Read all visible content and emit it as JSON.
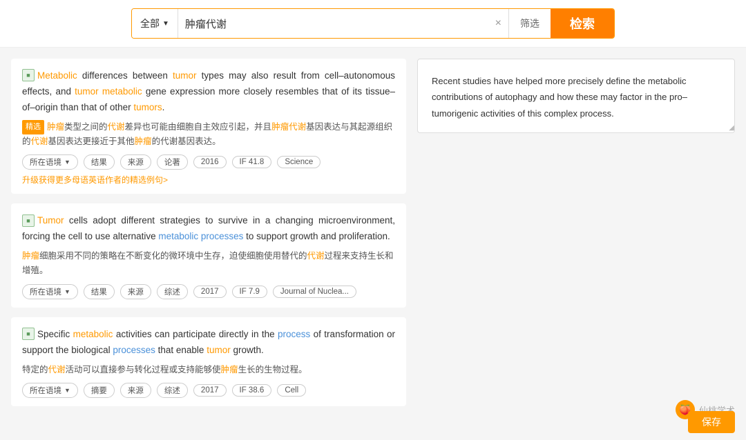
{
  "search": {
    "category_label": "全部",
    "query": "肿瘤代谢",
    "filter_label": "筛选",
    "search_label": "检索",
    "clear_icon": "×"
  },
  "results": [
    {
      "id": 1,
      "icon_letter": "M",
      "en_parts": [
        {
          "text": "",
          "type": "normal"
        },
        {
          "text": "Metabolic",
          "type": "orange"
        },
        {
          "text": " differences between ",
          "type": "normal"
        },
        {
          "text": "tumor",
          "type": "orange"
        },
        {
          "text": " types may also result from cell–autonomous effects, and ",
          "type": "normal"
        },
        {
          "text": "tumor",
          "type": "orange"
        },
        {
          "text": " ",
          "type": "normal"
        },
        {
          "text": "metabolic",
          "type": "orange"
        },
        {
          "text": " gene expression more closely resembles that of its tissue–of–origin than that of other ",
          "type": "normal"
        },
        {
          "text": "tumors",
          "type": "orange"
        },
        {
          "text": ".",
          "type": "normal"
        }
      ],
      "zh_badge": "精选",
      "zh_parts": [
        {
          "text": "肿瘤",
          "type": "orange"
        },
        {
          "text": "类型之间的",
          "type": "normal"
        },
        {
          "text": "代谢",
          "type": "orange"
        },
        {
          "text": "差异也可能由细胞自主效应引起，并且",
          "type": "normal"
        },
        {
          "text": "肿瘤代谢",
          "type": "orange"
        },
        {
          "text": "基因表达与其起源组织的",
          "type": "normal"
        },
        {
          "text": "代谢",
          "type": "orange"
        },
        {
          "text": "基因表达更接近于其他",
          "type": "normal"
        },
        {
          "text": "肿瘤",
          "type": "orange"
        },
        {
          "text": "的代谢基因表达。",
          "type": "normal"
        }
      ],
      "tags": [
        "所在语境",
        "结果",
        "来源",
        "论著",
        "2016",
        "IF 41.8",
        "Science"
      ],
      "upgrade_text": "升级获得更多母语英语作者的精选例句>",
      "show_dropdown": [
        true,
        false,
        false,
        false,
        false,
        false,
        false
      ]
    },
    {
      "id": 2,
      "icon_letter": "T",
      "en_parts": [
        {
          "text": "Tumor",
          "type": "orange"
        },
        {
          "text": " cells adopt different strategies to survive in a changing microenvironment, forcing the cell to use alternative ",
          "type": "normal"
        },
        {
          "text": "metabolic processes",
          "type": "blue"
        },
        {
          "text": " to support growth and proliferation.",
          "type": "normal"
        }
      ],
      "zh_parts": [
        {
          "text": "肿瘤",
          "type": "orange"
        },
        {
          "text": "细胞采用不同的策略在不断变化的微环境中生存，迫使细胞使用替代的",
          "type": "normal"
        },
        {
          "text": "代谢",
          "type": "orange"
        },
        {
          "text": "过程来支持生长和增殖。",
          "type": "normal"
        }
      ],
      "tags": [
        "所在语境",
        "结果",
        "来源",
        "综述",
        "2017",
        "IF 7.9",
        "Journal of Nuclea..."
      ],
      "show_dropdown": [
        true,
        false,
        false,
        false,
        false,
        false,
        false
      ]
    },
    {
      "id": 3,
      "icon_letter": "S",
      "en_parts": [
        {
          "text": "Specific ",
          "type": "normal"
        },
        {
          "text": "metabolic",
          "type": "orange"
        },
        {
          "text": " activities can participate directly in the ",
          "type": "normal"
        },
        {
          "text": "process",
          "type": "blue"
        },
        {
          "text": " of transformation or support the biological ",
          "type": "normal"
        },
        {
          "text": "processes",
          "type": "blue"
        },
        {
          "text": " that enable ",
          "type": "normal"
        },
        {
          "text": "tumor",
          "type": "orange"
        },
        {
          "text": " growth.",
          "type": "normal"
        }
      ],
      "zh_parts": [
        {
          "text": "特定的",
          "type": "normal"
        },
        {
          "text": "代谢",
          "type": "orange"
        },
        {
          "text": "活动可以直接参与转化过程或支持能够使",
          "type": "normal"
        },
        {
          "text": "肿瘤",
          "type": "orange"
        },
        {
          "text": "生长的生物过程。",
          "type": "normal"
        }
      ],
      "tags": [
        "所在语境",
        "摘要",
        "来源",
        "综述",
        "2017",
        "IF 38.6",
        "Cell"
      ],
      "show_dropdown": [
        true,
        false,
        false,
        false,
        false,
        false,
        false
      ]
    }
  ],
  "preview": {
    "text": "Recent studies have helped more precisely define the metabolic contributions of autophagy and how these may factor in the pro–tumorigenic activities of this complex process."
  },
  "watermark": {
    "text": "仙桃学术"
  },
  "save_button": "保存"
}
